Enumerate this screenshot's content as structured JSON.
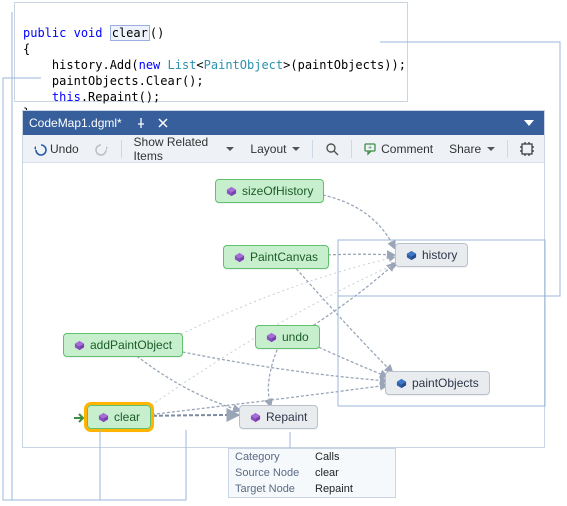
{
  "code": {
    "kw_public": "public",
    "kw_void": "void",
    "method": "clear",
    "parens": "()",
    "brace_open": "{",
    "line2_a": "    history.Add(",
    "kw_new": "new",
    "line2_b": " ",
    "typ_list": "List",
    "line2_c": "<",
    "typ_paint": "PaintObject",
    "line2_d": ">(paintObjects));",
    "line3": "    paintObjects.Clear();",
    "kw_this": "this",
    "line4_b": ".Repaint();",
    "brace_close": "}"
  },
  "codemap": {
    "title": "CodeMap1.dgml*",
    "toolbar": {
      "undo": "Undo",
      "show_related": "Show Related Items",
      "layout": "Layout",
      "comment": "Comment",
      "share": "Share"
    },
    "nodes": {
      "sizeOfHistory": "sizeOfHistory",
      "paintCanvas": "PaintCanvas",
      "addPaintObject": "addPaintObject",
      "undo": "undo",
      "clear": "clear",
      "history": "history",
      "paintObjects": "paintObjects",
      "repaint": "Repaint"
    }
  },
  "tooltip": {
    "k_category": "Category",
    "v_category": "Calls",
    "k_source": "Source Node",
    "v_source": "clear",
    "k_target": "Target Node",
    "v_target": "Repaint"
  },
  "colors": {
    "green": "#c7efce",
    "gray": "#e9ecef",
    "highlight": "#ffb400",
    "titlebar": "#365f9c"
  }
}
